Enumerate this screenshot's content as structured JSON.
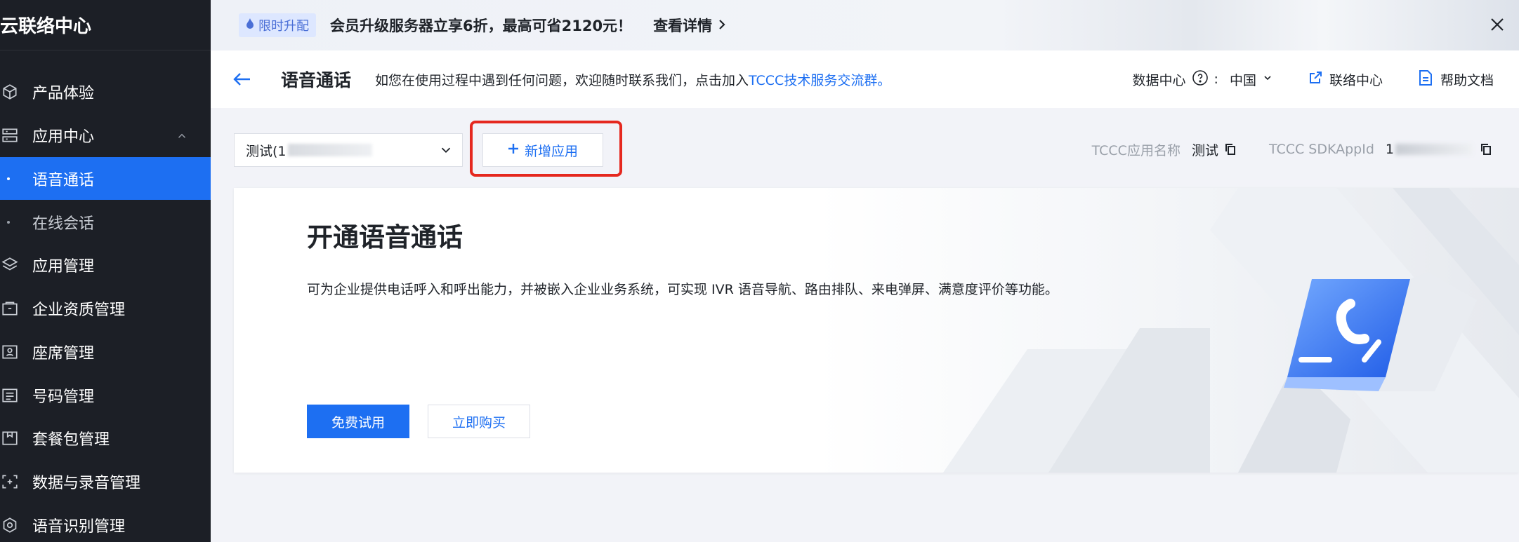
{
  "sidebar": {
    "brand": "云联络中心",
    "items": [
      {
        "label": "产品体验",
        "icon": "cube-icon"
      },
      {
        "label": "应用中心",
        "icon": "grid-icon"
      },
      {
        "label": "语音通话"
      },
      {
        "label": "在线会话"
      },
      {
        "label": "应用管理",
        "icon": "layers-icon"
      },
      {
        "label": "企业资质管理",
        "icon": "folder-icon"
      },
      {
        "label": "座席管理",
        "icon": "agent-icon"
      },
      {
        "label": "号码管理",
        "icon": "list-icon"
      },
      {
        "label": "套餐包管理",
        "icon": "package-icon"
      },
      {
        "label": "数据与录音管理",
        "icon": "scan-icon"
      },
      {
        "label": "语音识别管理",
        "icon": "gear-icon"
      }
    ]
  },
  "banner": {
    "tag": "限时升配",
    "text": "会员升级服务器立享6折，最高可省2120元！",
    "link": "查看详情"
  },
  "header": {
    "title": "语音通话",
    "desc_prefix": "如您在使用过程中遇到任何问题，欢迎随时联系我们，点击加入",
    "desc_link": "TCCC技术服务交流群。",
    "datacenter_label": "数据中心",
    "datacenter_value": "中国",
    "contact_center": "联络中心",
    "help_docs": "帮助文档"
  },
  "toolbar": {
    "app_select_value": "测试(1",
    "add_app": "新增应用",
    "app_name_label": "TCCC应用名称",
    "app_name_value": "测试",
    "sdk_label": "TCCC SDKAppId",
    "sdk_value": "1"
  },
  "card": {
    "title": "开通语音通话",
    "desc": "可为企业提供电话呼入和呼出能力，并被嵌入企业业务系统，可实现 IVR 语音导航、路由排队、来电弹屏、满意度评价等功能。",
    "free_trial": "免费试用",
    "buy_now": "立即购买"
  },
  "colors": {
    "accent": "#1d6ff2",
    "sidebar_bg": "#1c1f26",
    "highlight": "#e5281f"
  }
}
